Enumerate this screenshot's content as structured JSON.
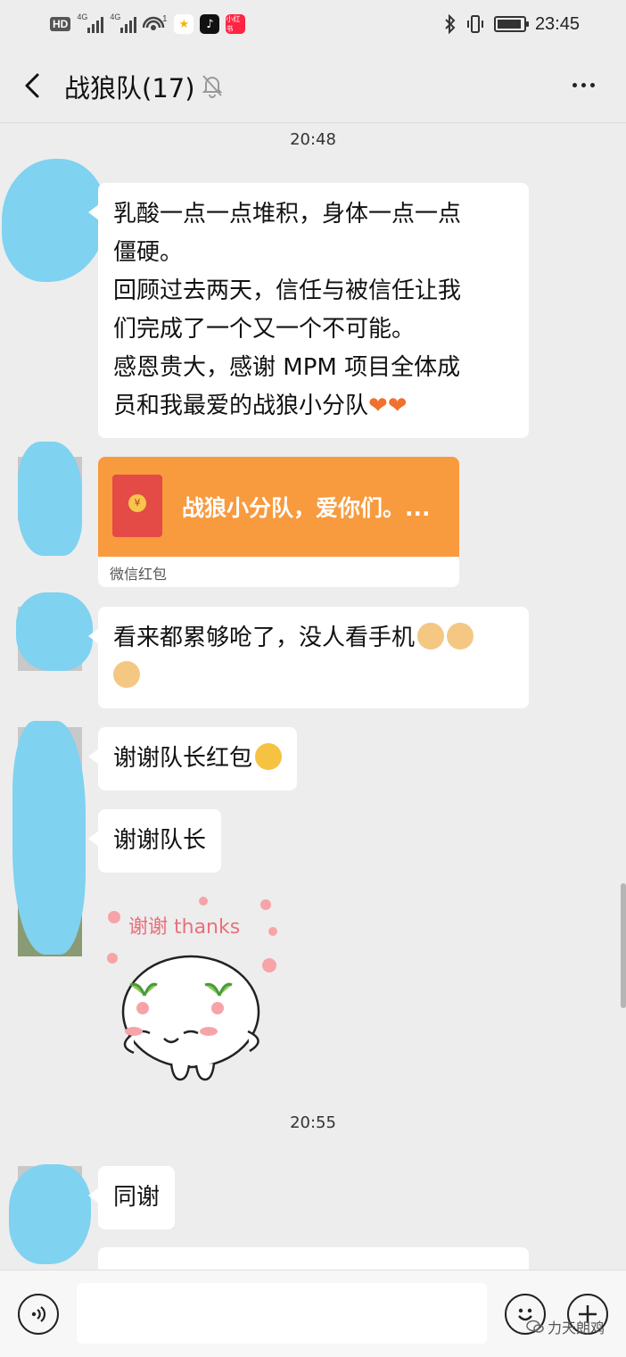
{
  "status_bar": {
    "hd_label": "HD",
    "net1": "4G",
    "net2": "4G",
    "wifi_count": "1",
    "app_badge": "小红书",
    "time": "23:45"
  },
  "header": {
    "title": "战狼队(17)"
  },
  "messages": {
    "ts1": "20:48",
    "m1_lines": [
      "乳酸一点一点堆积，身体一点一点",
      "僵硬。",
      "回顾过去两天，信任与被信任让我",
      "们完成了一个又一个不可能。",
      "感恩贵大，感谢 MPM 项目全体成",
      "员和我最爱的战狼小分队"
    ],
    "red_packet_title": "战狼小分队，爱你们。...",
    "red_packet_label": "微信红包",
    "m3_line1": "看来都累够呛了，没人看手机",
    "m4": "谢谢队长红包",
    "m5": "谢谢队长",
    "sticker_text": "谢谢 thanks",
    "ts2": "20:55",
    "m6": "同谢"
  },
  "watermark": "力天朗鸡",
  "colors": {
    "background": "#ededed",
    "bubble": "#ffffff",
    "red_packet": "#f89a3e",
    "blur": "#7fd2f0"
  },
  "icons": [
    "back-arrow-icon",
    "mute-bell-icon",
    "more-dots-icon",
    "voice-icon",
    "emoji-icon",
    "plus-icon"
  ]
}
